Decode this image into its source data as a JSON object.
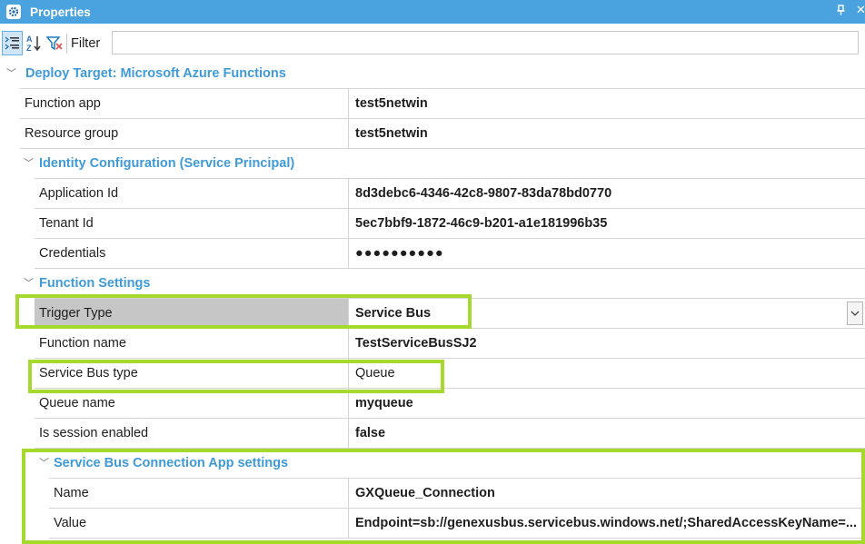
{
  "window": {
    "title": "Properties",
    "icon": "gear-icon",
    "pin_glyph": "᎘",
    "close_glyph": "✕"
  },
  "toolbar": {
    "categorized_icon": "categorized-view-icon",
    "alphabetical_icon": "sort-az-icon",
    "filter_icon": "funnel-icon",
    "filter_label": "Filter",
    "filter_value": ""
  },
  "grid": {
    "section_deploy": "Deploy Target: Microsoft Azure Functions",
    "function_app_label": "Function app",
    "function_app_value": "test5netwin",
    "resource_group_label": "Resource group",
    "resource_group_value": "test5netwin",
    "section_identity": "Identity Configuration (Service Principal)",
    "application_id_label": "Application Id",
    "application_id_value": "8d3debc6-4346-42c8-9807-83da78bd0770",
    "tenant_id_label": "Tenant Id",
    "tenant_id_value": "5ec7bbf9-1872-46c9-b201-a1e181996b35",
    "credentials_label": "Credentials",
    "credentials_value": "●●●●●●●●●●",
    "section_function": "Function Settings",
    "trigger_type_label": "Trigger Type",
    "trigger_type_value": "Service Bus",
    "function_name_label": "Function name",
    "function_name_value": "TestServiceBusSJ2",
    "service_bus_type_label": "Service Bus type",
    "service_bus_type_value": "Queue",
    "queue_name_label": "Queue name",
    "queue_name_value": "myqueue",
    "session_enabled_label": "Is session enabled",
    "session_enabled_value": "false",
    "section_connection": "Service Bus Connection App settings",
    "name_label": "Name",
    "name_value": "GXQueue_Connection",
    "value_label": "Value",
    "value_value": "Endpoint=sb://genexusbus.servicebus.windows.net/;SharedAccessKeyName=..."
  },
  "colors": {
    "title_bar": "#4aa3df",
    "category_text": "#3f9ad8",
    "highlight_box": "#a6d92d",
    "selected_row": "#c6c6c6"
  }
}
